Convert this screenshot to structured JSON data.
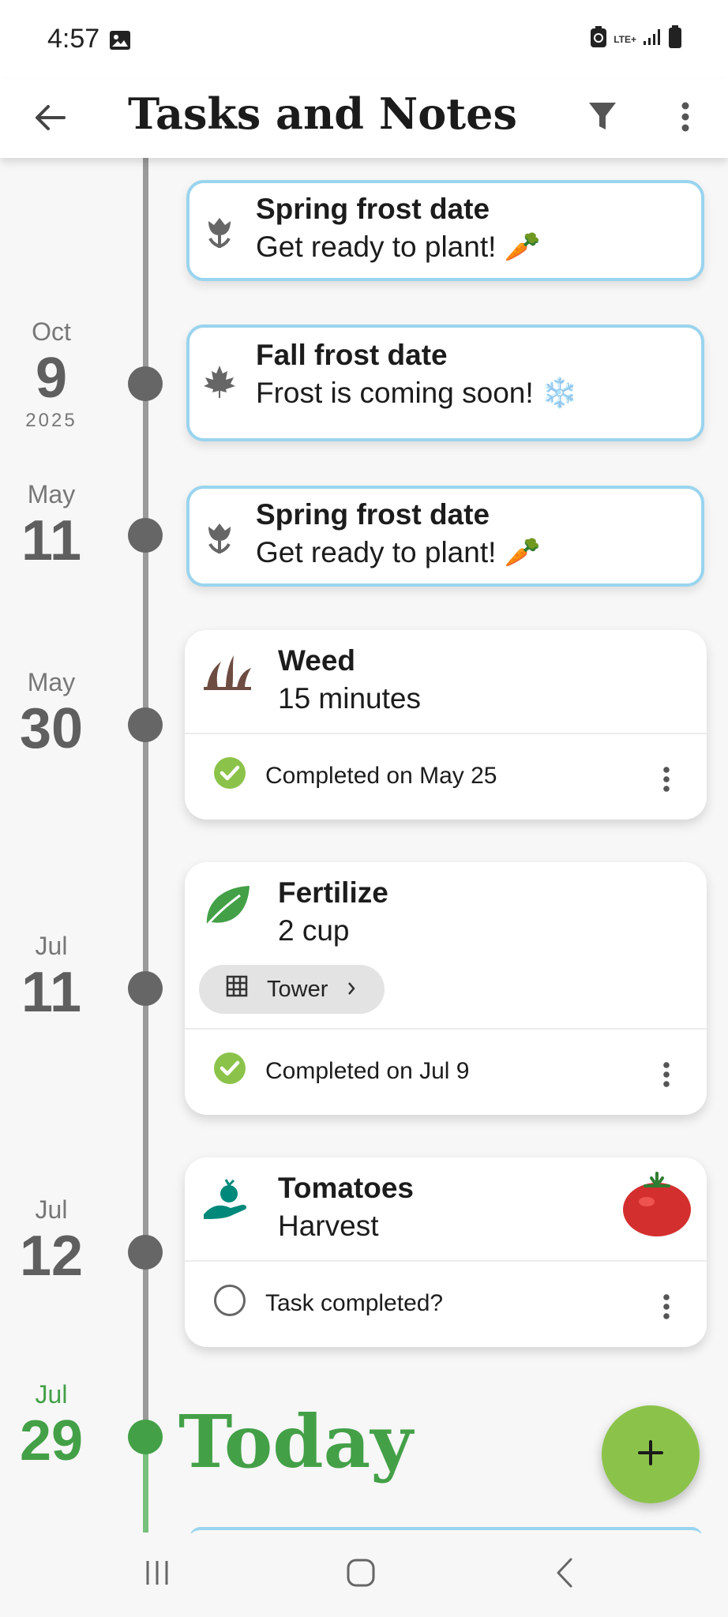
{
  "status_bar": {
    "time": "4:57",
    "network": "LTE+",
    "icons": [
      "gallery-icon",
      "recycle-icon",
      "signal-icon",
      "battery-icon"
    ]
  },
  "app_bar": {
    "title": "Tasks and Notes",
    "icons": [
      "arrow-left-icon",
      "filter-icon",
      "more-vert-icon"
    ]
  },
  "dates": [
    {
      "month": "Oct",
      "day": "9",
      "year": "2025"
    },
    {
      "month": "May",
      "day": "11"
    },
    {
      "month": "May",
      "day": "30"
    },
    {
      "month": "Jul",
      "day": "11"
    },
    {
      "month": "Jul",
      "day": "12"
    },
    {
      "month": "Jul",
      "day": "29"
    }
  ],
  "frost_cards": [
    {
      "title": "Spring frost date",
      "subtitle": "Get ready to plant! 🥕",
      "icon": "tulip-icon"
    },
    {
      "title": "Fall frost date",
      "subtitle": "Frost is coming soon! ❄️",
      "icon": "maple-leaf-icon"
    },
    {
      "title": "Spring frost date",
      "subtitle": "Get ready to plant! 🥕",
      "icon": "tulip-icon"
    }
  ],
  "tasks": [
    {
      "name": "Weed",
      "detail": "15 minutes",
      "status": "Completed on May 25",
      "icon": "weed-icon",
      "completed": true
    },
    {
      "name": "Fertilize",
      "detail": "2 cup",
      "chip": "Tower",
      "status": "Completed on Jul 9",
      "icon": "leaf-icon",
      "completed": true
    },
    {
      "name": "Tomatoes",
      "detail": "Harvest",
      "status": "Task completed?",
      "icon": "harvest-hand-icon",
      "completed": false
    }
  ],
  "today_label": "Today",
  "fab_label": "+",
  "colors": {
    "accent_green": "#43a047",
    "fab_green": "#8bc34a",
    "frost_border": "#9ad4ee",
    "timeline_gray": "#9a9a9a"
  }
}
